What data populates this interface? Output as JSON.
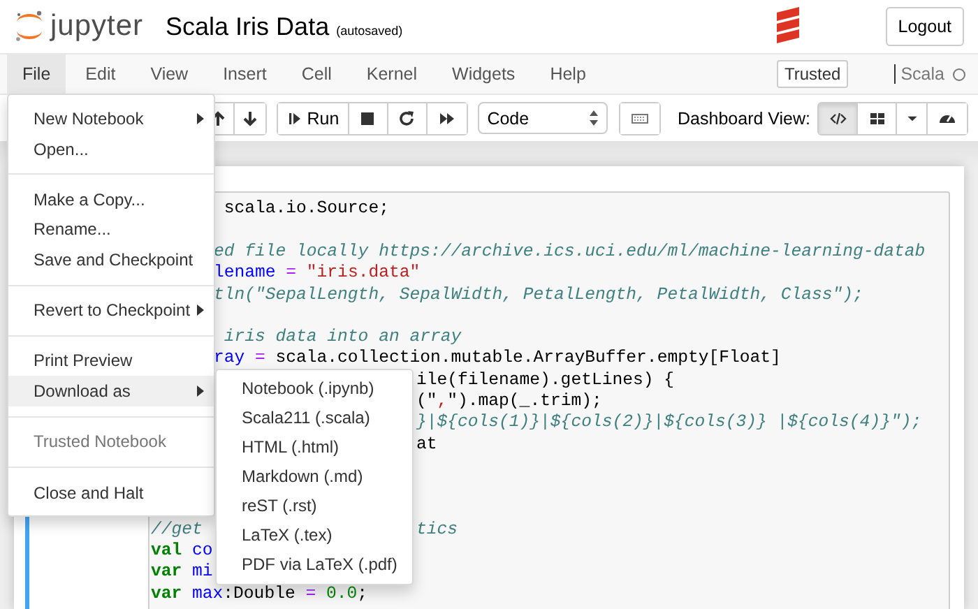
{
  "header": {
    "logo_text": "jupyter",
    "title": "Scala Iris Data",
    "save_status": "(autosaved)",
    "logout": "Logout"
  },
  "menubar": {
    "items": [
      {
        "label": "File",
        "selected": true
      },
      {
        "label": "Edit",
        "selected": false
      },
      {
        "label": "View",
        "selected": false
      },
      {
        "label": "Insert",
        "selected": false
      },
      {
        "label": "Cell",
        "selected": false
      },
      {
        "label": "Kernel",
        "selected": false
      },
      {
        "label": "Widgets",
        "selected": false
      },
      {
        "label": "Help",
        "selected": false
      }
    ],
    "trusted": "Trusted",
    "kernel": {
      "name": "Scala",
      "busy": false
    }
  },
  "toolbar": {
    "run": "Run",
    "cell_type": "Code",
    "dashboard_label": "Dashboard View:",
    "views": [
      {
        "selected": true
      },
      {
        "selected": false
      }
    ]
  },
  "file_menu": [
    {
      "kind": "item",
      "label": "New Notebook",
      "submenu": true,
      "selected": false,
      "disabled": false
    },
    {
      "kind": "item",
      "label": "Open...",
      "submenu": false,
      "selected": false,
      "disabled": false
    },
    {
      "kind": "divider"
    },
    {
      "kind": "item",
      "label": "Make a Copy...",
      "submenu": false,
      "selected": false,
      "disabled": false
    },
    {
      "kind": "item",
      "label": "Rename...",
      "submenu": false,
      "selected": false,
      "disabled": false
    },
    {
      "kind": "item",
      "label": "Save and Checkpoint",
      "submenu": false,
      "selected": false,
      "disabled": false
    },
    {
      "kind": "divider"
    },
    {
      "kind": "item",
      "label": "Revert to Checkpoint",
      "submenu": true,
      "selected": false,
      "disabled": false
    },
    {
      "kind": "divider"
    },
    {
      "kind": "item",
      "label": "Print Preview",
      "submenu": false,
      "selected": false,
      "disabled": false
    },
    {
      "kind": "item",
      "label": "Download as",
      "submenu": true,
      "selected": true,
      "disabled": false
    },
    {
      "kind": "divider"
    },
    {
      "kind": "item",
      "label": "Trusted Notebook",
      "submenu": false,
      "selected": false,
      "disabled": true
    },
    {
      "kind": "divider"
    },
    {
      "kind": "item",
      "label": "Close and Halt",
      "submenu": false,
      "selected": false,
      "disabled": false
    }
  ],
  "download_menu": [
    "Notebook (.ipynb)",
    "Scala211 (.scala)",
    "HTML (.html)",
    "Markdown (.md)",
    "reST (.rst)",
    "LaTeX (.tex)",
    "PDF via LaTeX (.pdf)"
  ],
  "code_cell": {
    "beside_file_menu": [
      {
        "gap_before": false,
        "right": [
          {
            "kind": "plain",
            "text": " scala.io.Source;"
          }
        ]
      },
      {
        "gap_before": true,
        "right": [
          {
            "kind": "comment",
            "text": "ed file locally https://archive.ics.uci.edu/ml/machine-learning-datab"
          }
        ]
      },
      {
        "gap_before": false,
        "right": [
          {
            "kind": "var",
            "text": "lename"
          },
          {
            "kind": "op",
            "text": " = "
          },
          {
            "kind": "string",
            "text": "\"iris.data\""
          }
        ]
      },
      {
        "gap_before": false,
        "right": [
          {
            "kind": "comment",
            "text": "tln(\"SepalLength, SepalWidth, PetalLength, PetalWidth, Class\");"
          }
        ]
      },
      {
        "gap_before": true,
        "right": [
          {
            "kind": "comment",
            "text": " iris data into an array"
          }
        ]
      },
      {
        "gap_before": false,
        "right": [
          {
            "kind": "var",
            "text": "ray"
          },
          {
            "kind": "op",
            "text": " = "
          },
          {
            "kind": "plain",
            "text": "scala.collection.mutable.ArrayBuffer.empty[Float]"
          }
        ]
      }
    ],
    "beside_both_menus": [
      {
        "gap_before": false,
        "right": [
          {
            "kind": "plain",
            "text": "ile(filename).getLines) {"
          }
        ]
      },
      {
        "gap_before": false,
        "right": [
          {
            "kind": "plain",
            "text": "(\""
          },
          {
            "kind": "string",
            "text": ","
          },
          {
            "kind": "plain",
            "text": "\").map(_.trim);"
          }
        ]
      },
      {
        "gap_before": false,
        "right": [
          {
            "kind": "comment",
            "text": "}|${cols(1)}|${cols(2)}|${cols(3)} |${cols(4)}\");"
          }
        ]
      },
      {
        "gap_before": false,
        "right": [
          {
            "kind": "plain",
            "text": "at"
          }
        ]
      }
    ],
    "beside_submenu": [
      {
        "gap_before": false,
        "left": [
          {
            "kind": "comment",
            "text": "//get"
          }
        ],
        "right": [
          {
            "kind": "comment",
            "text": "tics"
          }
        ]
      },
      {
        "gap_before": false,
        "left": [
          {
            "kind": "keyword",
            "text": "val"
          },
          {
            "kind": "var",
            "text": " co"
          }
        ]
      },
      {
        "gap_before": false,
        "left": [
          {
            "kind": "keyword",
            "text": "var"
          },
          {
            "kind": "var",
            "text": " mi"
          }
        ]
      }
    ],
    "below_menus": [
      {
        "gap_before": false,
        "left": [
          {
            "kind": "keyword",
            "text": "var"
          },
          {
            "kind": "var",
            "text": " max"
          },
          {
            "kind": "plain",
            "text": ":Double "
          },
          {
            "kind": "op",
            "text": "="
          },
          {
            "kind": "number",
            "text": " 0.0"
          },
          {
            "kind": "plain",
            "text": ";"
          }
        ]
      }
    ]
  }
}
